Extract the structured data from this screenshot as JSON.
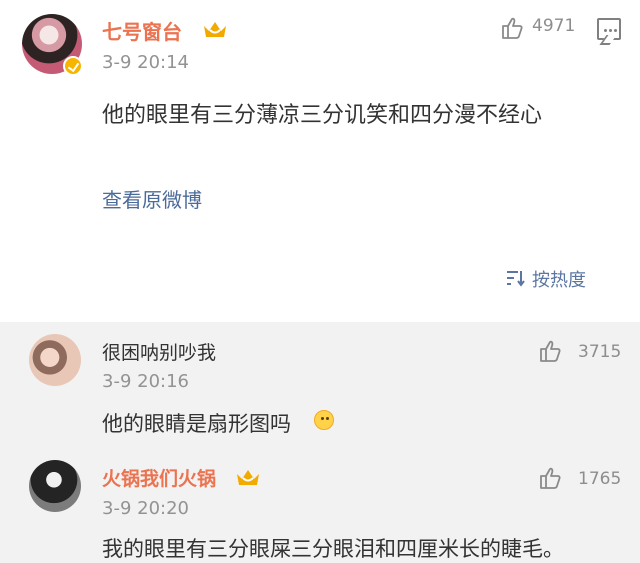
{
  "post": {
    "username": "七号窗台",
    "timestamp": "3-9 20:14",
    "like_count": "4971",
    "text": "他的眼里有三分薄凉三分讥笑和四分漫不经心",
    "view_original": "查看原微博",
    "sort_label": "按热度",
    "icons": {
      "avatar": "avatar-image",
      "verified": "verified-check-icon",
      "crown": "crown-badge-icon",
      "like": "thumbs-up-icon",
      "comment": "comment-bubble-icon",
      "sort": "sort-icon"
    }
  },
  "replies": [
    {
      "username": "很困呐别吵我",
      "timestamp": "3-9 20:16",
      "like_count": "3715",
      "text": "他的眼睛是扇形图吗"
    },
    {
      "username": "火锅我们火锅",
      "timestamp": "3-9 20:20",
      "like_count": "1765",
      "text": "我的眼里有三分眼屎三分眼泪和四厘米长的睫毛。"
    }
  ],
  "colors": {
    "username": "#eb7350",
    "link": "#4b6b9a",
    "secondary_text": "#939393",
    "reply_background": "#f2f2f2"
  }
}
